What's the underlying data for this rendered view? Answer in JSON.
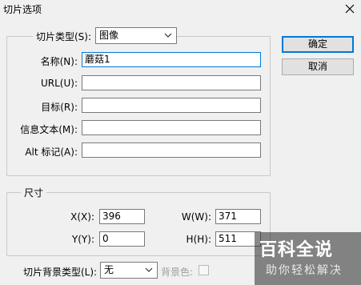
{
  "dialog": {
    "title": "切片选项",
    "ok_label": "确定",
    "cancel_label": "取消"
  },
  "slice": {
    "type_label": "切片类型(S):",
    "type_value": "图像",
    "name_label": "名称(N):",
    "name_value": "蘑菇1",
    "url_label": "URL(U):",
    "url_value": "",
    "target_label": "目标(R):",
    "target_value": "",
    "message_label": "信息文本(M):",
    "message_value": "",
    "alt_label": "Alt 标记(A):",
    "alt_value": ""
  },
  "dimensions": {
    "group_label": "尺寸",
    "x_label": "X(X):",
    "x_value": "396",
    "y_label": "Y(Y):",
    "y_value": "0",
    "w_label": "W(W):",
    "w_value": "371",
    "h_label": "H(H):",
    "h_value": "511"
  },
  "background": {
    "type_label": "切片背景类型(L):",
    "type_value": "无",
    "color_label": "背景色:"
  },
  "watermark": {
    "main": "百科全说",
    "sub": "助你轻松解决"
  }
}
